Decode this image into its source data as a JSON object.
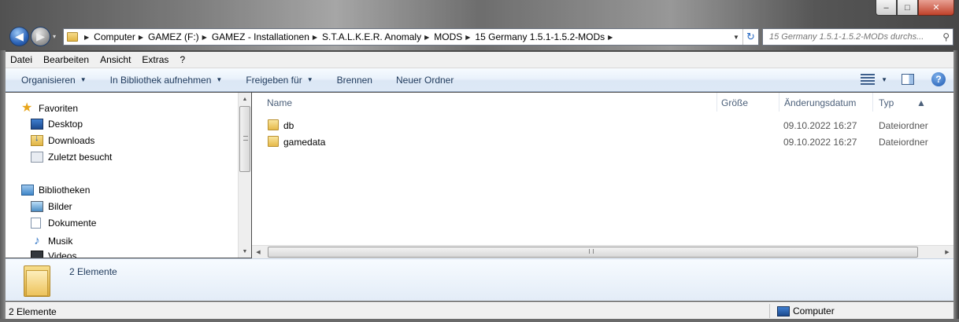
{
  "window": {
    "minimize": "–",
    "maximize": "□",
    "close": "✕"
  },
  "navigation": {
    "back": "◀",
    "forward": "▶",
    "recent": "▾"
  },
  "address": {
    "crumbs": [
      "Computer",
      "GAMEZ (F:)",
      "GAMEZ - Installationen",
      "S.T.A.L.K.E.R. Anomaly",
      "MODS",
      "15 Germany 1.5.1-1.5.2-MODs"
    ]
  },
  "search": {
    "placeholder": "15 Germany 1.5.1-1.5.2-MODs durchs..."
  },
  "menubar": {
    "items": [
      "Datei",
      "Bearbeiten",
      "Ansicht",
      "Extras",
      "?"
    ]
  },
  "toolbar": {
    "organize": "Organisieren",
    "library": "In Bibliothek aufnehmen",
    "share": "Freigeben für",
    "burn": "Brennen",
    "new_folder": "Neuer Ordner"
  },
  "navpane": {
    "favorites": "Favoriten",
    "desktop": "Desktop",
    "downloads": "Downloads",
    "recent": "Zuletzt besucht",
    "libraries": "Bibliotheken",
    "pictures": "Bilder",
    "documents": "Dokumente",
    "music": "Musik",
    "videos": "Videos"
  },
  "filelist": {
    "columns": {
      "name": "Name",
      "size": "Größe",
      "modified": "Änderungsdatum",
      "type": "Typ"
    },
    "rows": [
      {
        "name": "db",
        "date": "09.10.2022 16:27",
        "type": "Dateiordner"
      },
      {
        "name": "gamedata",
        "date": "09.10.2022 16:27",
        "type": "Dateiordner"
      }
    ]
  },
  "details": {
    "count": "2 Elemente"
  },
  "statusbar": {
    "count": "2 Elemente",
    "location": "Computer"
  }
}
